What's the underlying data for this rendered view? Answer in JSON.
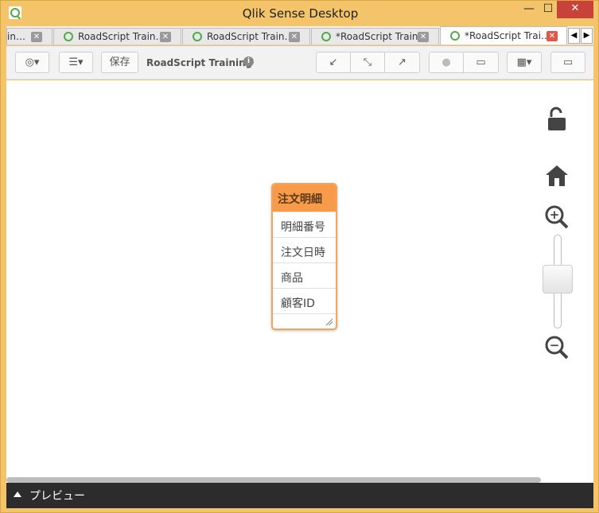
{
  "window": {
    "title": "Qlik Sense Desktop",
    "minimize": "—",
    "maximize": "☐",
    "close": "✕"
  },
  "tabs": [
    {
      "label": "in…",
      "close": "✕",
      "active": false
    },
    {
      "label": "RoadScript Train…",
      "close": "✕",
      "active": false
    },
    {
      "label": "RoadScript Train…",
      "close": "✕",
      "active": false
    },
    {
      "label": "*RoadScript Train…",
      "close": "✕",
      "active": false
    },
    {
      "label": "*RoadScript Trai…",
      "close": "✕",
      "active": true
    }
  ],
  "tab_nav": {
    "prev": "◀",
    "next": "▶"
  },
  "toolbar": {
    "navigation_menu": "◎▾",
    "list_menu": "☰▾",
    "save_label": "保存",
    "app_name": "RoadScript Training",
    "info": "i",
    "collapse_all": "↙",
    "show_links": "⤡",
    "expand_all": "↗",
    "internal_view": "●",
    "source_view": "▭",
    "layout_menu": "▦▾",
    "preview_toggle": "▭"
  },
  "table": {
    "name": "注文明細",
    "fields": [
      "明細番号",
      "注文日時",
      "商品",
      "顧客ID"
    ]
  },
  "zoom": {
    "in_icon": "+",
    "out_icon": "−",
    "level": 0.55
  },
  "preview": {
    "label": "プレビュー"
  },
  "colors": {
    "accent": "#f79b4a",
    "frame": "#f3c46a",
    "close": "#c7433a"
  }
}
